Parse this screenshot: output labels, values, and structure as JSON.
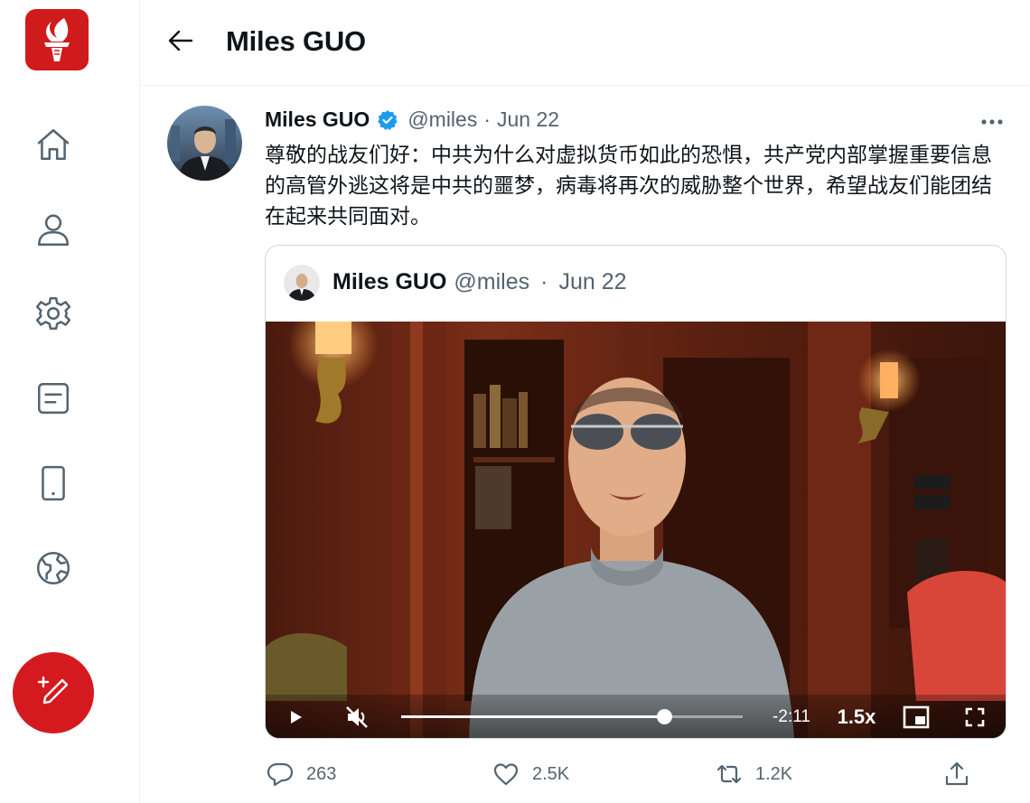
{
  "header": {
    "title": "Miles GUO"
  },
  "tweet": {
    "name": "Miles GUO",
    "handle": "@miles",
    "separator": "·",
    "date": "Jun 22",
    "text": "尊敬的战友们好：中共为什么对虚拟货币如此的恐惧，共产党内部掌握重要信息的高管外逃这将是中共的噩梦，病毒将再次的威胁整个世界，希望战友们能团结在起来共同面对。"
  },
  "quote": {
    "name": "Miles GUO",
    "handle": "@miles",
    "separator": "·",
    "date": "Jun 22"
  },
  "video": {
    "time_remaining": "-2:11",
    "speed": "1.5x",
    "progress": 0.77
  },
  "actions": {
    "replies": "263",
    "likes": "2.5K",
    "retweets": "1.2K"
  },
  "colors": {
    "brand_red": "#cf1b1b",
    "compose_red": "#d51a1f",
    "verified_blue": "#1d9bf0",
    "muted_gray": "#536471"
  },
  "icons": [
    "torch-logo-icon",
    "home-icon",
    "profile-icon",
    "settings-icon",
    "notes-icon",
    "phone-icon",
    "globe-icon",
    "compose-icon",
    "back-arrow-icon",
    "verified-badge-icon",
    "more-icon",
    "play-icon",
    "mute-icon",
    "pip-icon",
    "fullscreen-icon",
    "reply-icon",
    "like-icon",
    "retweet-icon",
    "share-icon"
  ]
}
